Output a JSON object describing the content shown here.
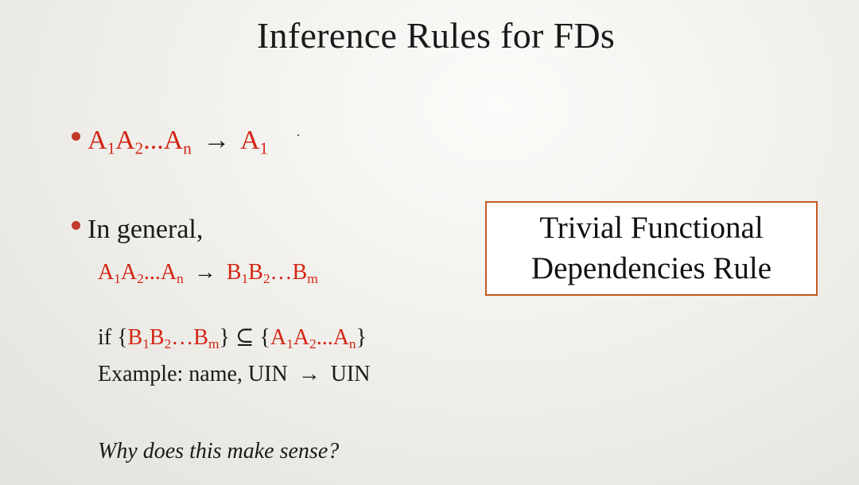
{
  "slide": {
    "title": "Inference Rules for FDs",
    "bullet1": {
      "lhs": [
        {
          "base": "A",
          "sub": "1"
        },
        {
          "base": "A",
          "sub": "2"
        },
        {
          "base": "...A",
          "sub": "n"
        }
      ],
      "arrow": "→",
      "rhs": [
        {
          "base": "A",
          "sub": "1"
        }
      ]
    },
    "bullet2": {
      "text": "In general,",
      "rule": {
        "lhs": [
          {
            "base": "A",
            "sub": "1"
          },
          {
            "base": "A",
            "sub": "2"
          },
          {
            "base": "...A",
            "sub": "n"
          }
        ],
        "arrow": "→",
        "rhs": [
          {
            "base": "B",
            "sub": "1"
          },
          {
            "base": "B",
            "sub": "2"
          },
          {
            "base": "…B",
            "sub": "m"
          }
        ]
      },
      "condition": {
        "prefix": "if {",
        "set_b": [
          {
            "base": "B",
            "sub": "1"
          },
          {
            "base": "B",
            "sub": "2"
          },
          {
            "base": "…B",
            "sub": "m"
          }
        ],
        "subset_symbol": "} ⊆ {",
        "set_a": [
          {
            "base": "A",
            "sub": "1"
          },
          {
            "base": "A",
            "sub": "2"
          },
          {
            "base": "...A",
            "sub": "n"
          }
        ],
        "suffix": "}"
      },
      "example": {
        "prefix": "Example: name, UIN",
        "arrow": "→",
        "suffix": "UIN"
      },
      "question": "Why does this make sense?"
    },
    "callout": {
      "line1": "Trivial Functional",
      "line2": "Dependencies Rule"
    },
    "colors": {
      "accent_red": "#d32514",
      "bullet_dot": "#c0392b",
      "callout_border": "#c55a26"
    }
  }
}
